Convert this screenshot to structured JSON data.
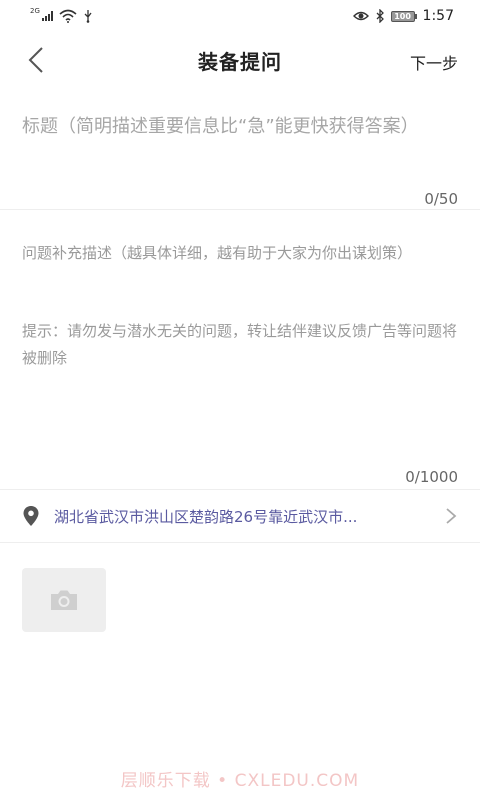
{
  "status_bar": {
    "network": "2G",
    "battery": "100",
    "time": "1:57"
  },
  "header": {
    "title": "装备提问",
    "next_label": "下一步"
  },
  "title_field": {
    "placeholder": "标题（简明描述重要信息比“急”能更快获得答案）",
    "counter": "0/50"
  },
  "description_field": {
    "placeholder": "问题补充描述（越具体详细，越有助于大家为你出谋划策）",
    "tip": "提示：请勿发与潜水无关的问题，转让结伴建议反馈广告等问题将被删除",
    "counter": "0/1000"
  },
  "location": {
    "text": "湖北省武汉市洪山区楚韵路26号靠近武汉市..."
  },
  "watermark": "层顺乐下载 • CXLEDU.COM",
  "colors": {
    "location_text": "#5a5aa0",
    "placeholder": "#a6a6a6",
    "watermark": "#f3c6c6"
  }
}
